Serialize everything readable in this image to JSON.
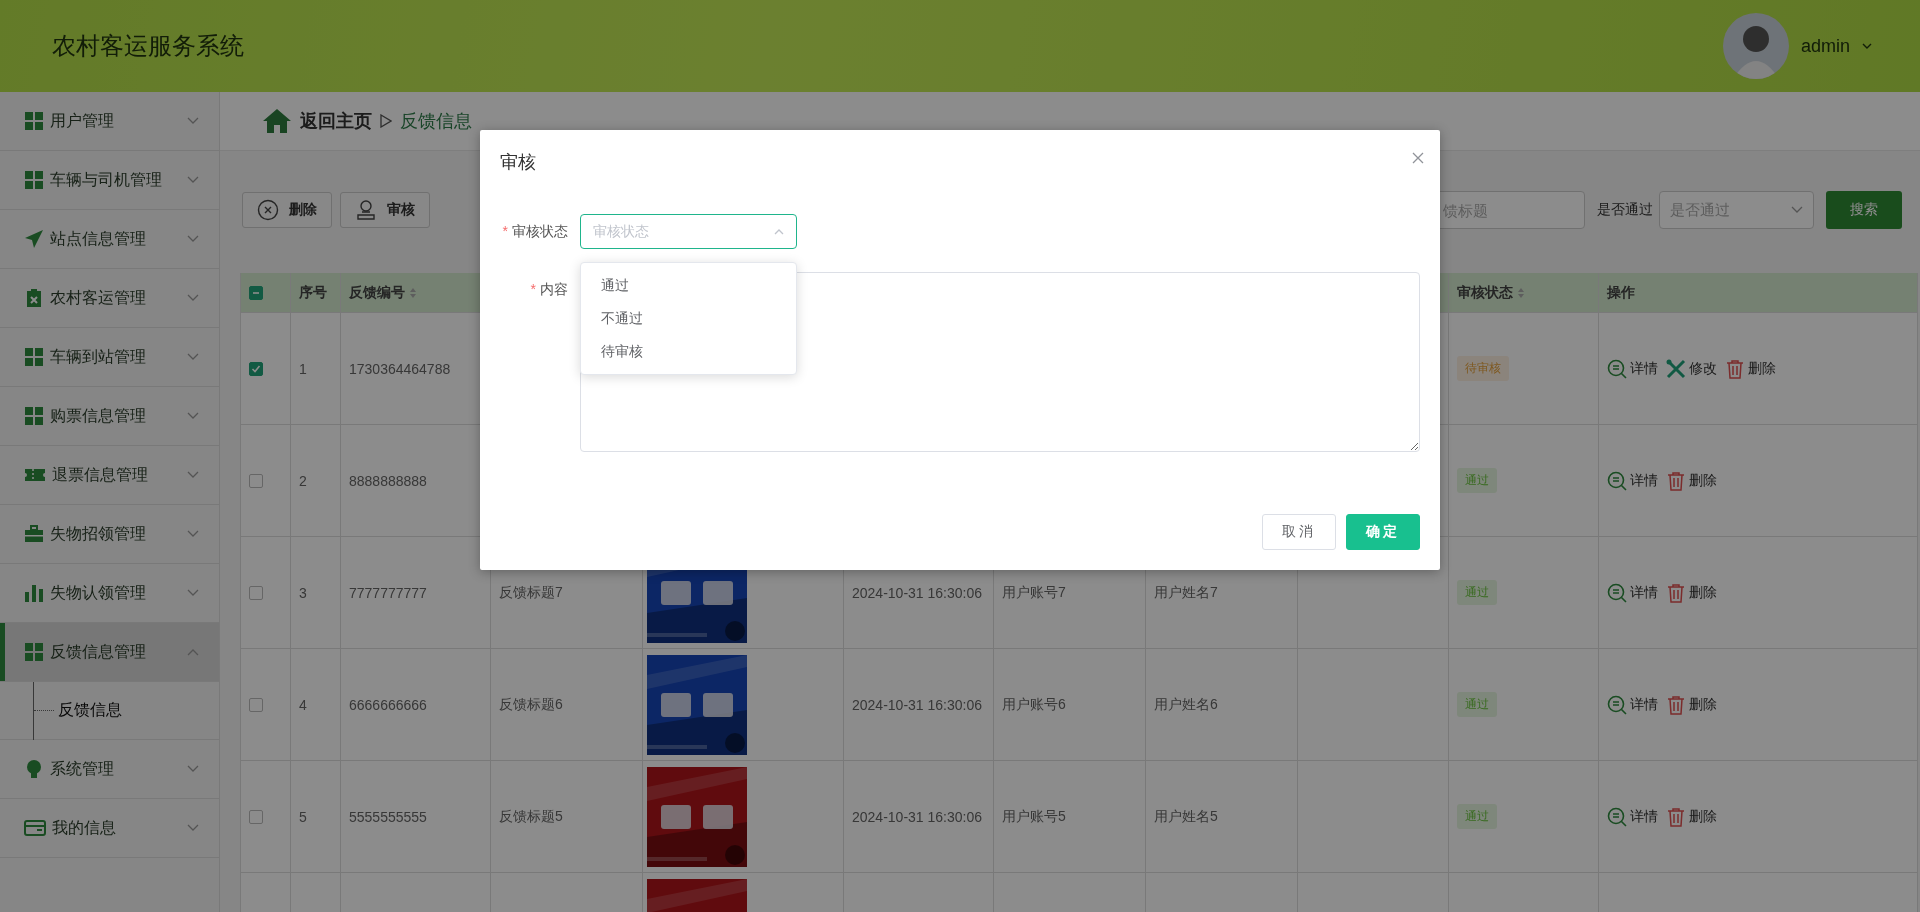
{
  "app": {
    "title": "农村客运服务系统",
    "user": "admin"
  },
  "sidebar": {
    "items": [
      {
        "label": "用户管理",
        "expanded": false,
        "selected": false
      },
      {
        "label": "车辆与司机管理",
        "expanded": false,
        "selected": false
      },
      {
        "label": "站点信息管理",
        "expanded": false,
        "selected": false
      },
      {
        "label": "农村客运管理",
        "expanded": false,
        "selected": false
      },
      {
        "label": "车辆到站管理",
        "expanded": false,
        "selected": false
      },
      {
        "label": "购票信息管理",
        "expanded": false,
        "selected": false
      },
      {
        "label": "退票信息管理",
        "expanded": false,
        "selected": false
      },
      {
        "label": "失物招领管理",
        "expanded": false,
        "selected": false
      },
      {
        "label": "失物认领管理",
        "expanded": false,
        "selected": false
      },
      {
        "label": "反馈信息管理",
        "expanded": true,
        "selected": true,
        "children": [
          {
            "label": "反馈信息",
            "selected": true
          }
        ]
      },
      {
        "label": "系统管理",
        "expanded": false,
        "selected": false
      },
      {
        "label": "我的信息",
        "expanded": false,
        "selected": false
      }
    ]
  },
  "breadcrumb": {
    "home": "返回主页",
    "current": "反馈信息"
  },
  "toolbar": {
    "buttons": [
      {
        "label": "删除",
        "kind": "delete"
      },
      {
        "label": "审核",
        "kind": "audit"
      }
    ]
  },
  "search": {
    "fields": [
      {
        "kind": "input",
        "placeholder": "馈标题"
      },
      {
        "kind": "select",
        "label": "是否通过",
        "placeholder": "是否通过"
      }
    ],
    "button": "搜索"
  },
  "table": {
    "select_all": {
      "indeterminate": true
    },
    "columns": [
      {
        "label": "序号",
        "sortable": false
      },
      {
        "label": "反馈编号",
        "sortable": true
      },
      {
        "label": "审核状态",
        "sortable": true
      },
      {
        "label": "操作",
        "sortable": false
      }
    ],
    "rows": [
      {
        "checked": true,
        "index": "1",
        "id": "1730364464788",
        "status": {
          "label": "待审核",
          "kind": "pending"
        },
        "actions": [
          {
            "label": "详情",
            "kind": "detail"
          },
          {
            "label": "修改",
            "kind": "edit"
          },
          {
            "label": "删除",
            "kind": "delete"
          }
        ]
      },
      {
        "checked": false,
        "index": "2",
        "id": "8888888888",
        "status": {
          "label": "通过",
          "kind": "passed"
        },
        "actions": [
          {
            "label": "详情",
            "kind": "detail"
          },
          {
            "label": "删除",
            "kind": "delete"
          }
        ]
      },
      {
        "checked": false,
        "index": "3",
        "id": "7777777777",
        "title": "反馈标题7",
        "image": {
          "kind": "picture"
        },
        "date": "2024-10-31 16:30:06",
        "account": "用户账号7",
        "name": "用户姓名7",
        "status": {
          "label": "通过",
          "kind": "passed"
        },
        "actions": [
          {
            "label": "详情",
            "kind": "detail"
          },
          {
            "label": "删除",
            "kind": "delete"
          }
        ]
      },
      {
        "checked": false,
        "index": "4",
        "id": "6666666666",
        "title": "反馈标题6",
        "image": {
          "kind": "picture"
        },
        "date": "2024-10-31 16:30:06",
        "account": "用户账号6",
        "name": "用户姓名6",
        "status": {
          "label": "通过",
          "kind": "passed"
        },
        "actions": [
          {
            "label": "详情",
            "kind": "detail"
          },
          {
            "label": "删除",
            "kind": "delete"
          }
        ]
      },
      {
        "checked": false,
        "index": "5",
        "id": "5555555555",
        "title": "反馈标题5",
        "image": {
          "kind": "picture"
        },
        "date": "2024-10-31 16:30:06",
        "account": "用户账号5",
        "name": "用户姓名5",
        "status": {
          "label": "通过",
          "kind": "passed"
        },
        "actions": [
          {
            "label": "详情",
            "kind": "detail"
          },
          {
            "label": "删除",
            "kind": "delete"
          }
        ]
      },
      {
        "image": {
          "kind": "picture"
        }
      }
    ]
  },
  "dialog": {
    "title": "审核",
    "fields": [
      {
        "label": "审核状态",
        "required_mark": "*",
        "kind": "select",
        "placeholder": "审核状态",
        "open": true,
        "options": [
          {
            "label": "通过",
            "selected": false
          },
          {
            "label": "不通过",
            "selected": false
          },
          {
            "label": "待审核",
            "selected": false
          }
        ]
      },
      {
        "label": "内容",
        "required_mark": "*",
        "kind": "textarea"
      }
    ],
    "buttons": [
      {
        "label": "取消",
        "kind": "default"
      },
      {
        "label": "确定",
        "kind": "primary"
      }
    ]
  }
}
